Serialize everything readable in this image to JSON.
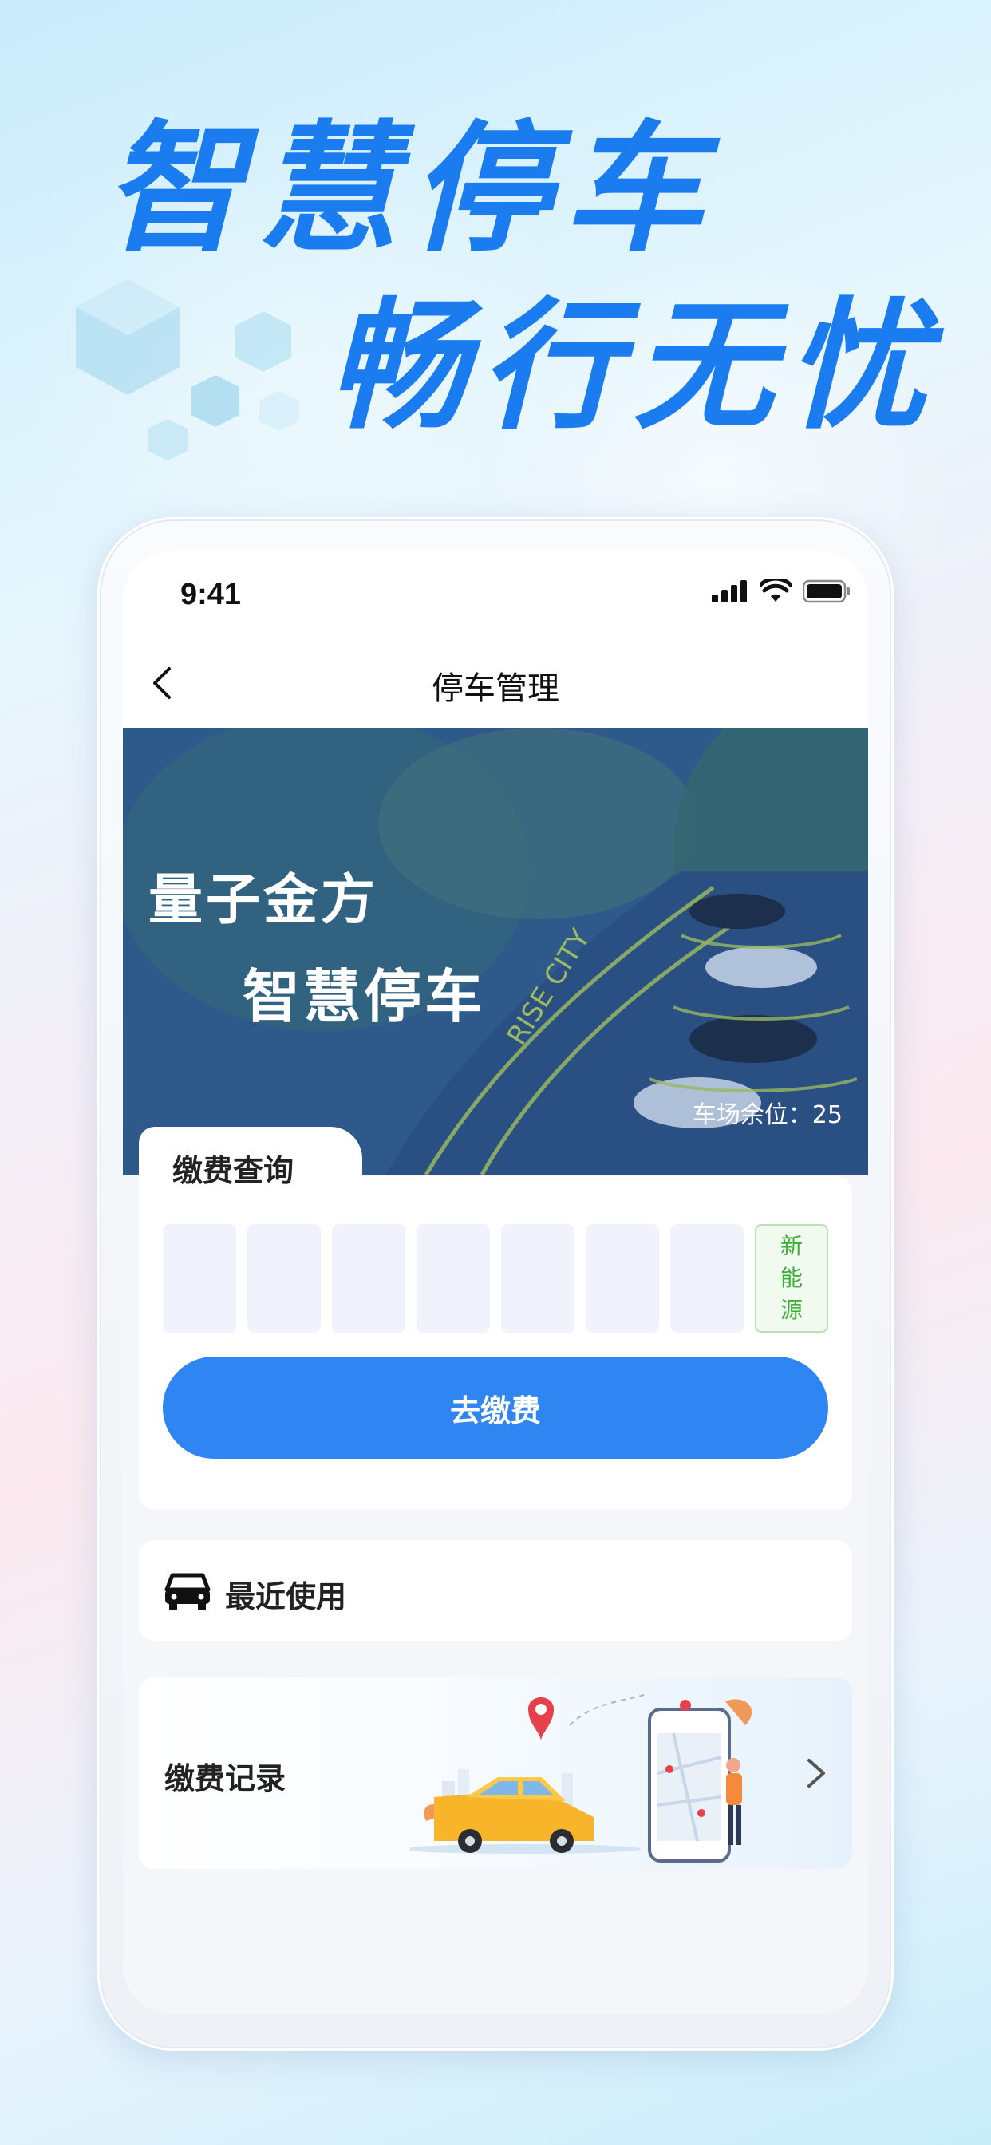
{
  "promo": {
    "headline_line1": "智慧停车",
    "headline_line2": "畅行无忧"
  },
  "status_bar": {
    "time": "9:41"
  },
  "nav": {
    "title": "停车管理"
  },
  "banner": {
    "title_line1": "量子金方",
    "title_line2": "智慧停车",
    "spaces_text": "车场余位：25",
    "road_text": "RISE CITY"
  },
  "payment": {
    "tab_title": "缴费查询",
    "plate_slots": 7,
    "ev_label": "新\n能\n源",
    "button_label": "去缴费"
  },
  "recent": {
    "label": "最近使用"
  },
  "records": {
    "label": "缴费记录"
  },
  "colors": {
    "primary_blue": "#2f86f2",
    "headline_blue": "#1b7cf0",
    "ev_green": "#3fae3a"
  }
}
